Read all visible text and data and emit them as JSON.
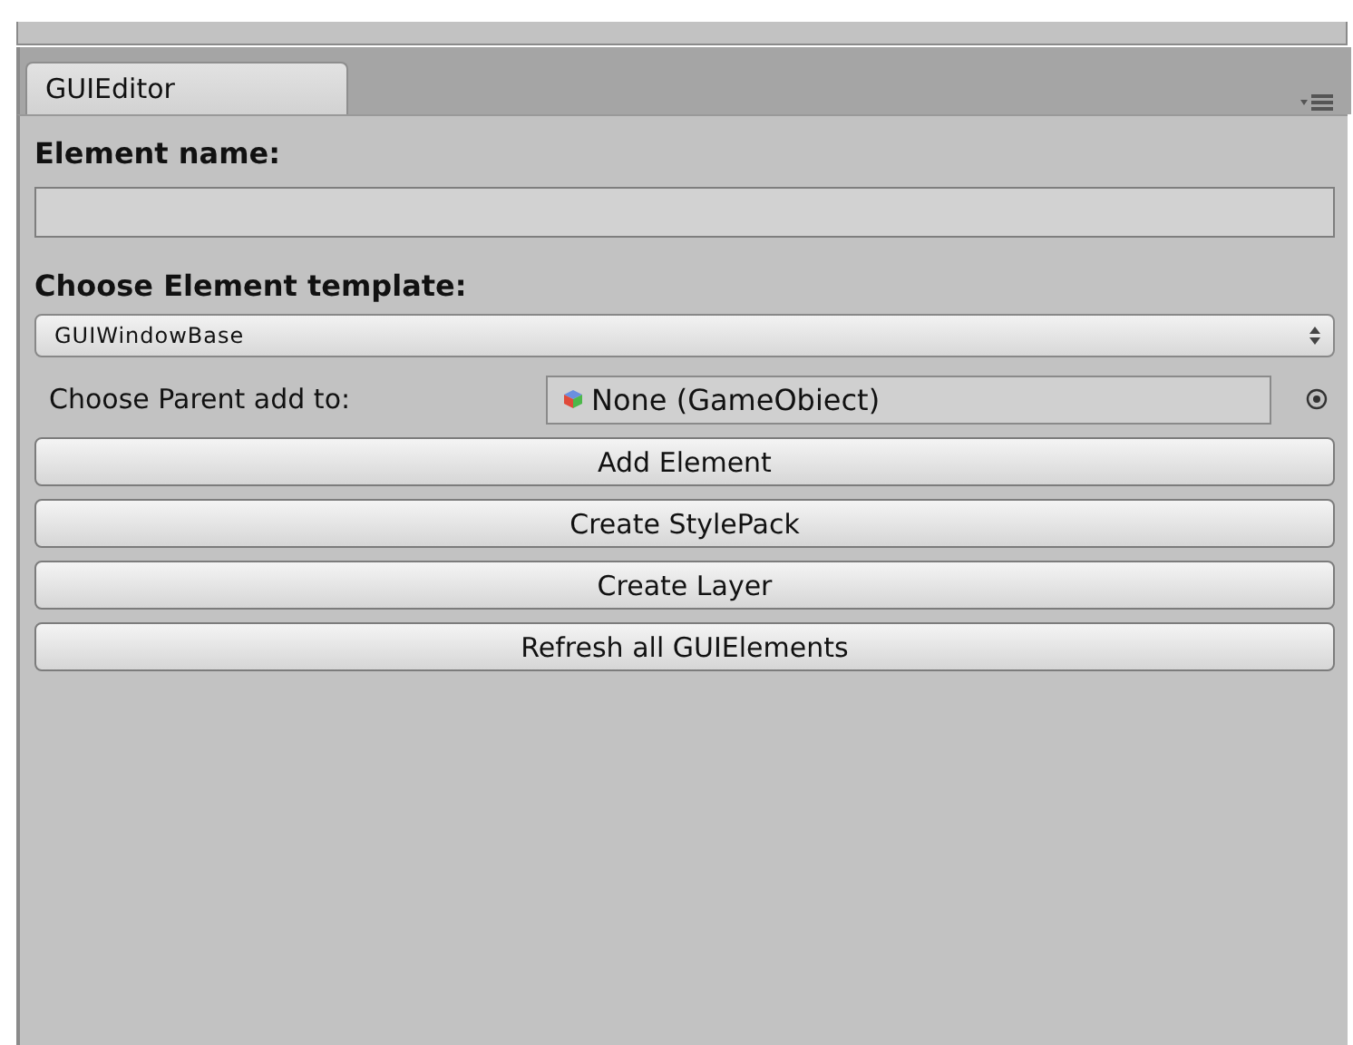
{
  "tabs": [
    {
      "label": "GUIEditor",
      "selected": true
    }
  ],
  "element_name": {
    "label": "Element name:"
  },
  "template": {
    "label": "Choose Element template:",
    "value": "GUIWindowBase"
  },
  "parent": {
    "label": "Choose Parent add to:",
    "value": "None (GameObiect)"
  },
  "buttons": [
    "Add Element",
    "Create StylePack",
    "Create Layer",
    "Refresh all GUIElements"
  ]
}
